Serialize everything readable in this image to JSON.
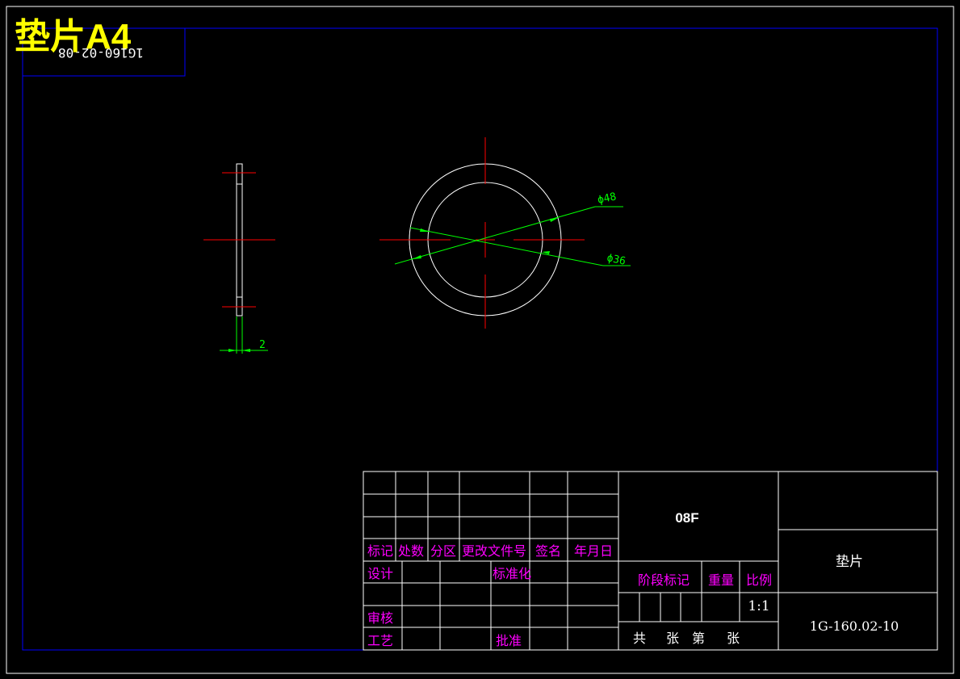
{
  "header": {
    "title": "垫片A4",
    "mirrored_code": "1G160-02-08"
  },
  "dimensions": {
    "outer_diameter": "ϕ48",
    "inner_diameter": "ϕ36",
    "thickness": "2"
  },
  "title_block": {
    "headers": [
      "标记",
      "处数",
      "分区",
      "更改文件号",
      "签名",
      "年月日"
    ],
    "design": "设计",
    "standardization": "标准化",
    "review": "审核",
    "process": "工艺",
    "approve": "批准",
    "material": "08F",
    "stage_mark": "阶段标记",
    "weight": "重量",
    "scale_label": "比例",
    "scale_value": "1:1",
    "sheets": [
      "共",
      "张",
      "第",
      "张"
    ],
    "part_name": "垫片",
    "drawing_number": "1G-160.02-10"
  },
  "colors": {
    "border_blue": "#0000ff",
    "center_red": "#ff0000",
    "dimension_green": "#00ff00",
    "label_magenta": "#ff00ff",
    "title_yellow": "#ffff00"
  }
}
